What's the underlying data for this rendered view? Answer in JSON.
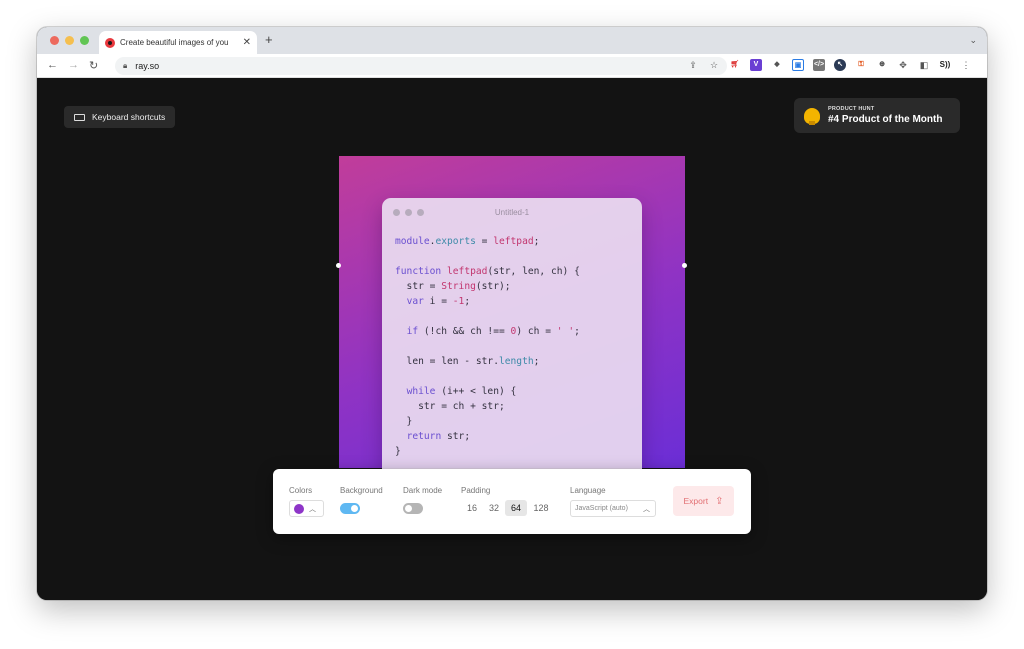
{
  "browser": {
    "tab_title": "Create beautiful images of you",
    "url": "ray.so"
  },
  "page": {
    "keyboard_shortcuts_label": "Keyboard shortcuts",
    "product_hunt": {
      "small": "PRODUCT HUNT",
      "big": "#4 Product of the Month"
    }
  },
  "editor": {
    "file_title": "Untitled-1",
    "code_lines": [
      "module.exports = leftpad;",
      "",
      "function leftpad(str, len, ch) {",
      "  str = String(str);",
      "  var i = -1;",
      "",
      "  if (!ch && ch !== 0) ch = ' ';",
      "",
      "  len = len - str.length;",
      "",
      "  while (i++ < len) {",
      "    str = ch + str;",
      "  }",
      "  return str;",
      "}"
    ]
  },
  "controls": {
    "colors_label": "Colors",
    "background_label": "Background",
    "dark_mode_label": "Dark mode",
    "padding_label": "Padding",
    "language_label": "Language",
    "padding_options": [
      "16",
      "32",
      "64",
      "128"
    ],
    "padding_selected": "64",
    "language_value": "JavaScript (auto)",
    "export_label": "Export",
    "background_on": true,
    "dark_mode_on": false
  },
  "colors": {
    "accent_swatch": "#8e35c8",
    "toggle_on": "#5fb8f2",
    "toggle_off": "#b5b5b5",
    "export_text": "#e26e72"
  },
  "icons": {
    "back": "arrow-left-icon",
    "forward": "arrow-right-icon",
    "reload": "reload-icon",
    "lock": "lock-icon",
    "share": "share-icon",
    "star": "star-icon",
    "extensions": "puzzle-icon",
    "sidebar": "sidebar-icon",
    "menu": "more-vertical-icon",
    "trophy": "trophy-icon",
    "keyboard": "keyboard-icon",
    "export": "share-icon"
  }
}
